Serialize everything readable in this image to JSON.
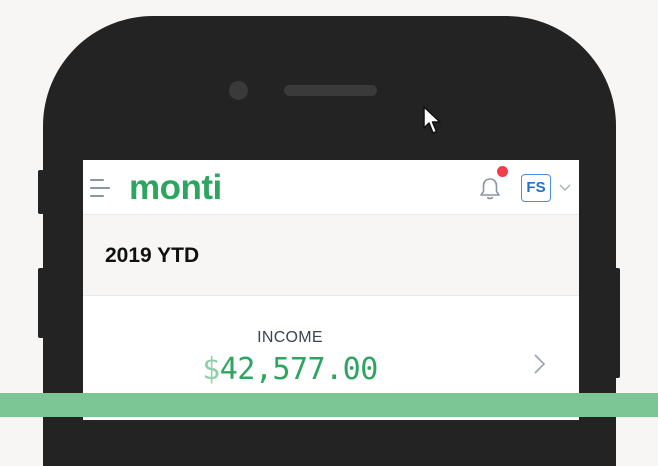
{
  "app": {
    "logo_text": "monti",
    "brand_color": "#2ea55f",
    "notification_dot_color": "#ef3e4a",
    "avatar_initials": "FS"
  },
  "header": {
    "menu_icon": "hamburger-menu-icon",
    "notification_icon": "bell-icon",
    "account_dropdown_icon": "chevron-down-icon"
  },
  "summary": {
    "period_title": "2019 YTD",
    "income": {
      "label": "INCOME",
      "currency_symbol": "$",
      "amount": "42,577.00",
      "row_icon": "chevron-right-icon"
    }
  }
}
